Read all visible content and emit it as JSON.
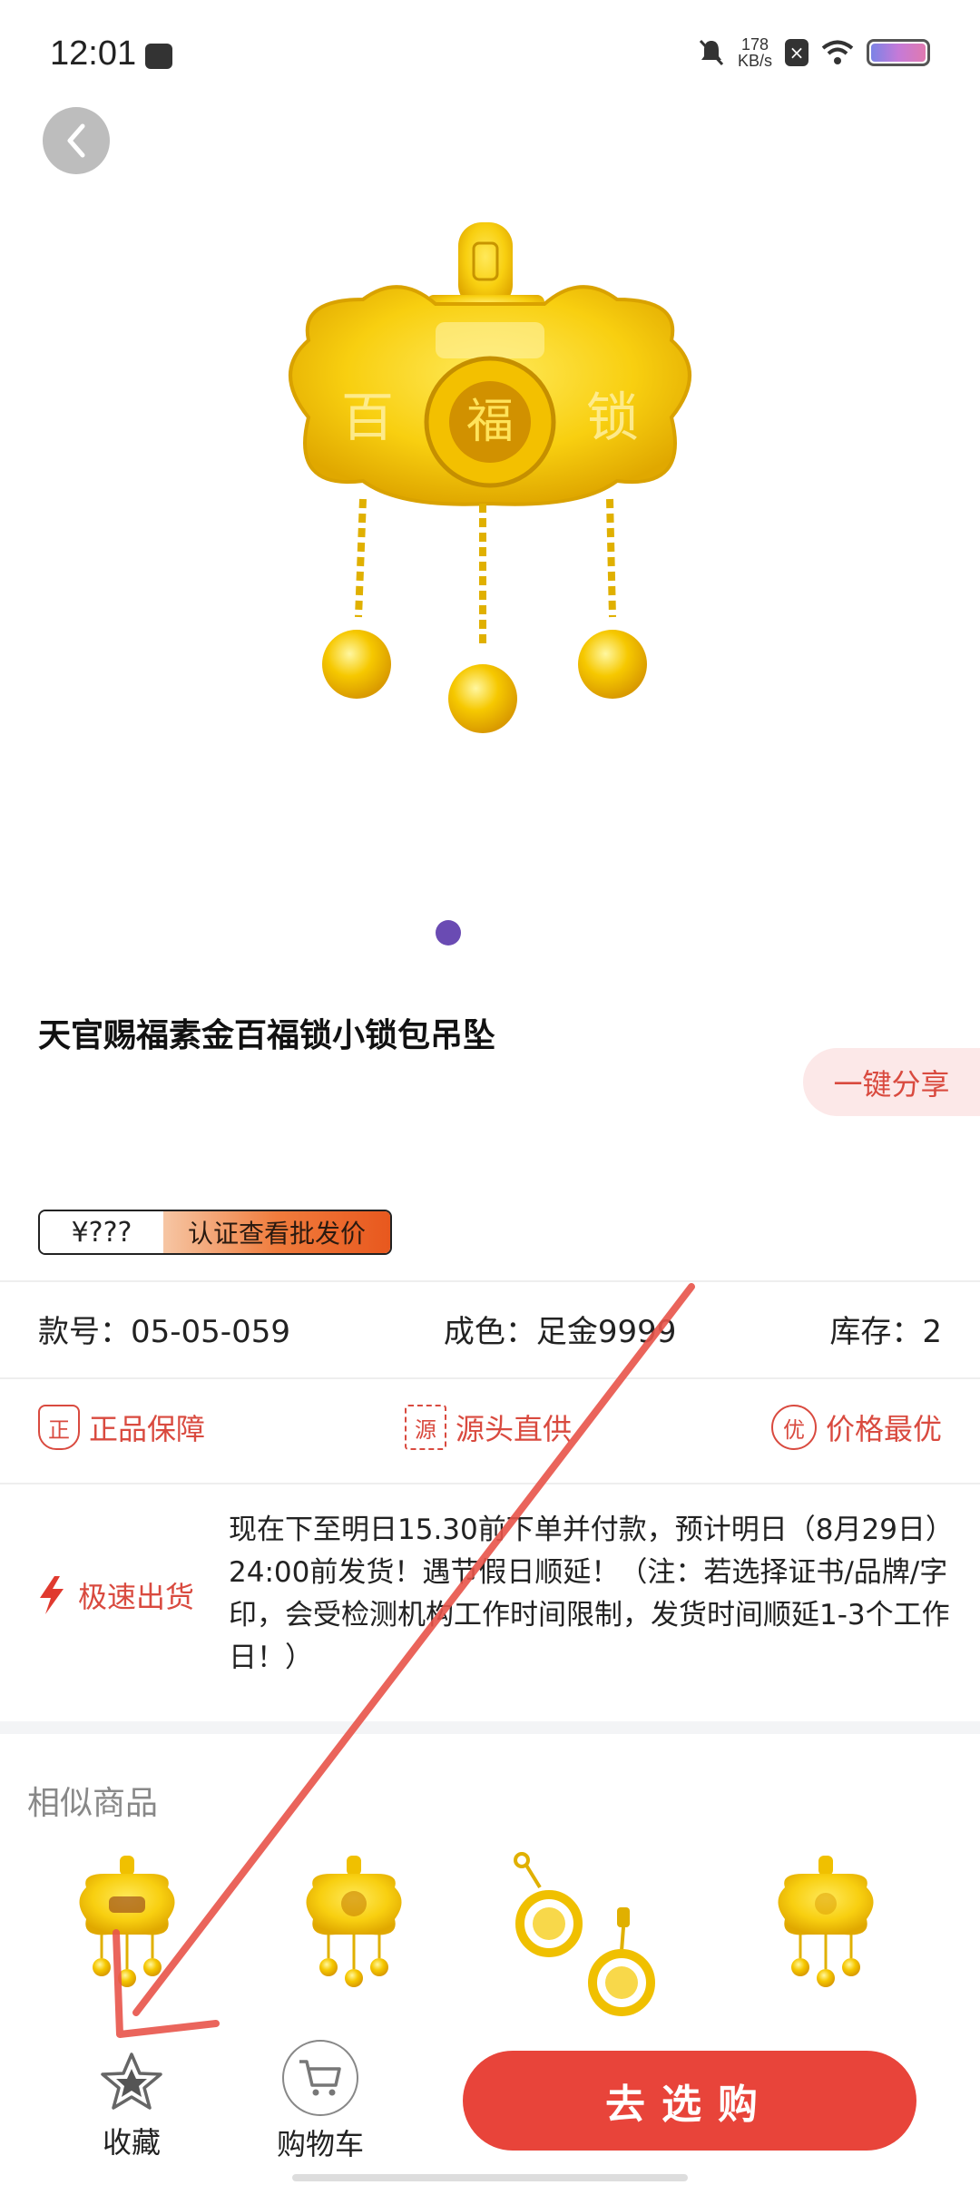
{
  "status_bar": {
    "time": "12:01",
    "net_speed_value": "178",
    "net_speed_unit": "KB/s"
  },
  "product": {
    "title": "天官赐福素金百福锁小锁包吊坠",
    "share_label": "一键分享",
    "price_hidden": "¥???",
    "price_cta": "认证查看批发价",
    "image_index": 1,
    "image_count": 1
  },
  "specs": {
    "model": "款号：05-05-059",
    "purity": "成色：足金9999",
    "stock": "库存：2"
  },
  "guarantees": {
    "authentic": "正品保障",
    "authentic_icon": "正",
    "source": "源头直供",
    "source_icon": "源",
    "best_price": "价格最优",
    "best_price_icon": "优"
  },
  "shipping": {
    "label": "极速出货",
    "text": "现在下至明日15.30前下单并付款，预计明日（8月29日）24:00前发货！遇节假日顺延！（注：若选择证书/品牌/字印，会受检测机构工作时间限制，发货时间顺延1-3个工作日！）"
  },
  "similar": {
    "title": "相似商品"
  },
  "bottom_bar": {
    "favorite_label": "收藏",
    "cart_label": "购物车",
    "buy_label": "去选购"
  },
  "colors": {
    "accent_red": "#e8443a",
    "guarantee_red": "#d94a3f",
    "gold": "#f5c400",
    "page_dot": "#6a4bb3"
  },
  "icons": [
    "back-icon",
    "bell-muted-icon",
    "wifi-icon",
    "battery-icon",
    "star-icon",
    "cart-icon",
    "lightning-icon"
  ]
}
